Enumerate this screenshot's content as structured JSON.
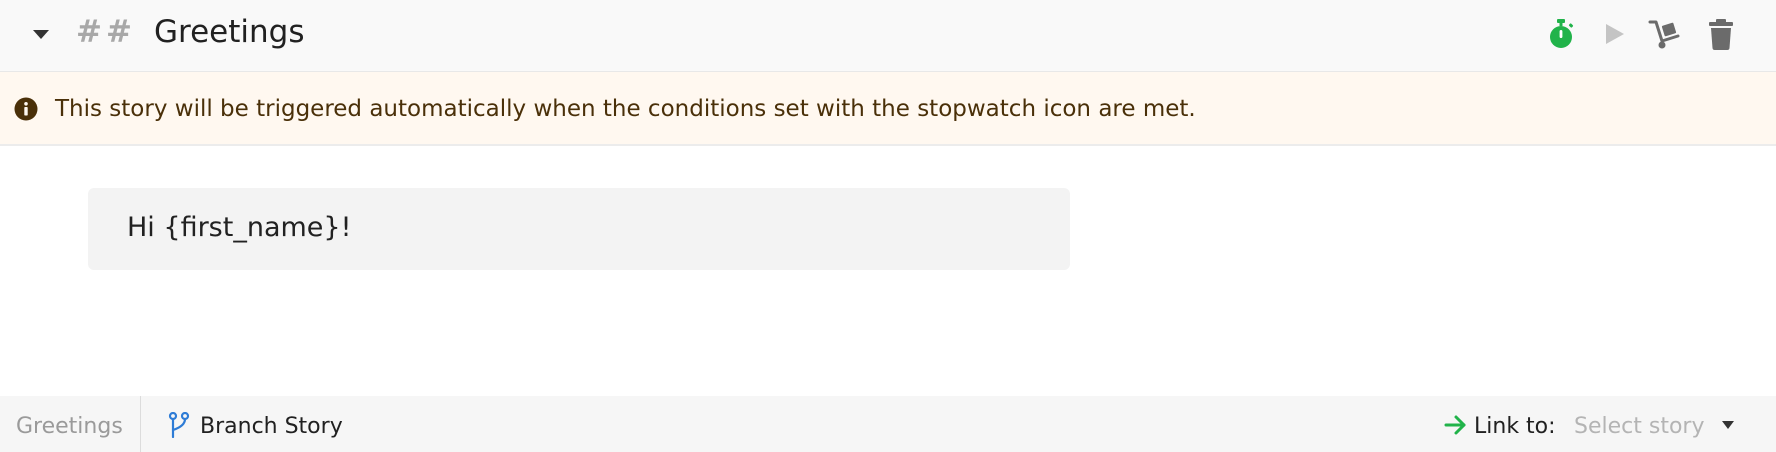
{
  "header": {
    "hashes": "##",
    "title": "Greetings",
    "icons": [
      "chevron-down-icon",
      "stopwatch-icon",
      "play-icon",
      "dolly-icon",
      "trash-icon"
    ],
    "colors": {
      "stopwatch": "#21b34a",
      "play": "#c4c4c4",
      "dolly": "#6b6b6b",
      "trash": "#6b6b6b"
    }
  },
  "banner": {
    "icon": "info-icon",
    "text": "This story will be triggered automatically when the conditions set with the stopwatch icon are met.",
    "background": "#fff8f0",
    "icon_color": "#4a3009"
  },
  "message": {
    "text": "Hi {first_name}!"
  },
  "footer": {
    "story_name": "Greetings",
    "branch_label": "Branch Story",
    "branch_icon_color": "#2e7cd6",
    "link_label": "Link to:",
    "link_arrow_color": "#21b34a",
    "select_placeholder": "Select story"
  }
}
